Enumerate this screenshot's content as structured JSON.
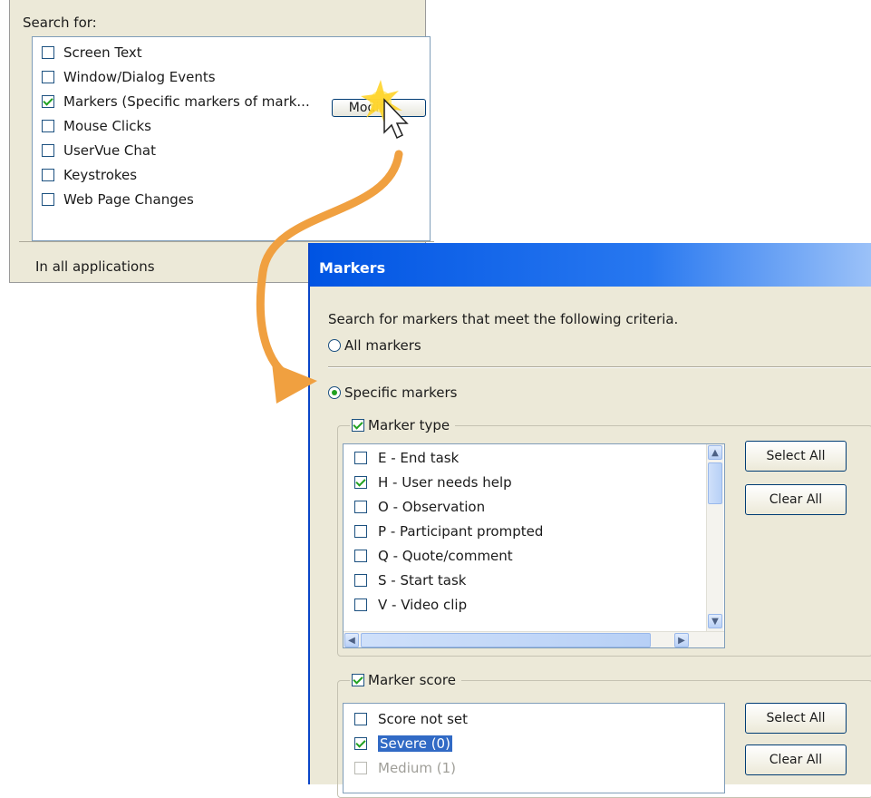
{
  "search_panel": {
    "title": "Search for:",
    "items": [
      {
        "label": "Screen Text",
        "checked": false
      },
      {
        "label": "Window/Dialog Events",
        "checked": false
      },
      {
        "label": "Markers (Specific markers of mark...",
        "checked": true
      },
      {
        "label": "Mouse Clicks",
        "checked": false
      },
      {
        "label": "UserVue Chat",
        "checked": false
      },
      {
        "label": "Keystrokes",
        "checked": false
      },
      {
        "label": "Web Page Changes",
        "checked": false
      }
    ],
    "modify_button": "Modify",
    "scope_text": "In all applications"
  },
  "dialog": {
    "title": "Markers",
    "criteria_text": "Search for markers that meet the following criteria.",
    "all_markers_label": "All markers",
    "specific_markers_label": "Specific markers",
    "selected_radio": "specific",
    "marker_type": {
      "label": "Marker type",
      "checked": true,
      "items": [
        {
          "label": "E - End task",
          "checked": false
        },
        {
          "label": "H - User needs help",
          "checked": true
        },
        {
          "label": "O - Observation",
          "checked": false
        },
        {
          "label": "P - Participant prompted",
          "checked": false
        },
        {
          "label": "Q - Quote/comment",
          "checked": false
        },
        {
          "label": "S - Start task",
          "checked": false
        },
        {
          "label": "V - Video clip",
          "checked": false
        }
      ],
      "select_all": "Select All",
      "clear_all": "Clear All"
    },
    "marker_score": {
      "label": "Marker score",
      "checked": true,
      "items": [
        {
          "label": "Score not set",
          "checked": false
        },
        {
          "label": "Severe (0)",
          "checked": true,
          "selected": true
        },
        {
          "label": "Medium (1)",
          "checked": false
        }
      ],
      "select_all": "Select All",
      "clear_all": "Clear All"
    }
  },
  "colors": {
    "title_bar": "#0054e3",
    "panel_bg": "#ece9d8",
    "arrow": "#f0a040",
    "selection": "#316ac5"
  }
}
